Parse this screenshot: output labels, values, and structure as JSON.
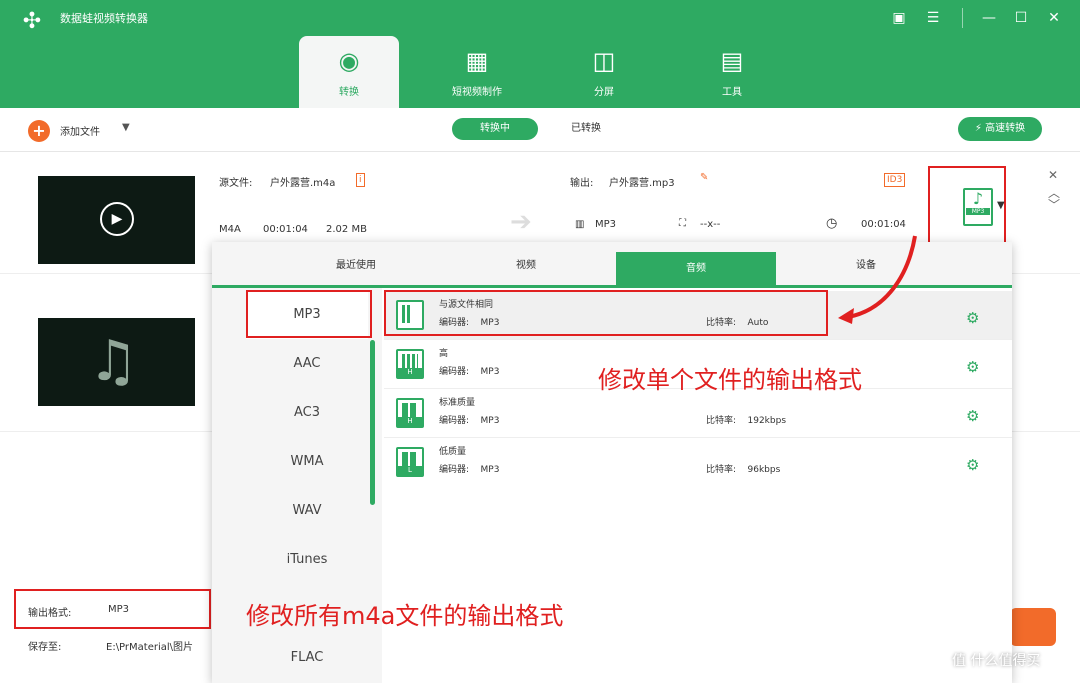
{
  "app": {
    "title": "数据蛙视频转换器"
  },
  "tabs": [
    {
      "label": "转换"
    },
    {
      "label": "短视频制作"
    },
    {
      "label": "分屏"
    },
    {
      "label": "工具"
    }
  ],
  "toolbar": {
    "add_file": "添加文件",
    "converting": "转换中",
    "converted": "已转换",
    "fast_convert": "高速转换"
  },
  "file": {
    "source_label": "源文件:",
    "source_name": "户外露营.m4a",
    "output_label": "输出:",
    "output_name": "户外露营.mp3",
    "in_format": "M4A",
    "in_duration": "00:01:04",
    "in_size": "2.02 MB",
    "out_format": "MP3",
    "out_res": "--x--",
    "out_duration": "00:01:04",
    "fmt_tag": "MP3",
    "id3": "ID3"
  },
  "panel": {
    "tabs": [
      "最近使用",
      "视频",
      "音频",
      "设备"
    ],
    "formats": [
      "MP3",
      "AAC",
      "AC3",
      "WMA",
      "WAV",
      "iTunes",
      "FLAC"
    ],
    "presets": [
      {
        "name": "与源文件相同",
        "encoder_label": "编码器:",
        "encoder": "MP3",
        "bitrate_label": "比特率:",
        "bitrate": "Auto",
        "tag": ""
      },
      {
        "name": "高",
        "encoder_label": "编码器:",
        "encoder": "MP3",
        "bitrate_label": "",
        "bitrate": "",
        "tag": "H"
      },
      {
        "name": "标准质量",
        "encoder_label": "编码器:",
        "encoder": "MP3",
        "bitrate_label": "比特率:",
        "bitrate": "192kbps",
        "tag": "H"
      },
      {
        "name": "低质量",
        "encoder_label": "编码器:",
        "encoder": "MP3",
        "bitrate_label": "比特率:",
        "bitrate": "96kbps",
        "tag": "L"
      }
    ]
  },
  "bottom": {
    "output_format_label": "输出格式:",
    "output_format": "MP3",
    "save_to_label": "保存至:",
    "save_path": "E:\\PrMaterial\\图片"
  },
  "annotations": {
    "single": "修改单个文件的输出格式",
    "all": "修改所有m4a文件的输出格式"
  },
  "watermark": "值 什么值得买"
}
